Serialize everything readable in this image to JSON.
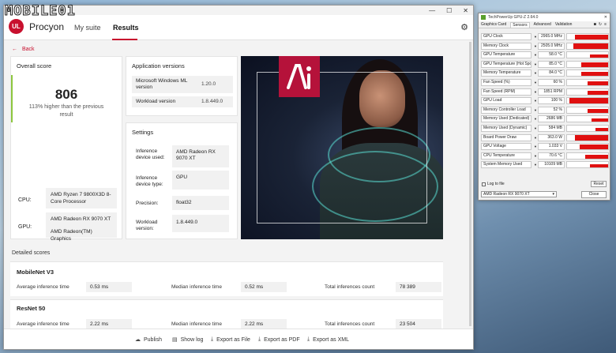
{
  "watermark": "MOBILE01",
  "window": {
    "minimize": "—",
    "maximize": "☐",
    "close": "✕"
  },
  "app": {
    "logo": "UL",
    "name": "Procyon",
    "tabs": [
      "My suite",
      "Results"
    ]
  },
  "back_label": "Back",
  "overall": {
    "title": "Overall score",
    "score": "806",
    "comparison": "113% higher than the previous result",
    "cpu_label": "CPU:",
    "cpu_value": "AMD Ryzen 7 9800X3D 8-Core Processor",
    "gpu_label": "GPU:",
    "gpu_values": [
      "AMD Radeon RX 9070 XT",
      "AMD Radeon(TM) Graphics"
    ]
  },
  "app_versions": {
    "title": "Application versions",
    "rows": [
      {
        "label": "Microsoft Windows ML version",
        "value": "1.20.0"
      },
      {
        "label": "Workload version",
        "value": "1.8.449.0"
      }
    ]
  },
  "settings": {
    "title": "Settings",
    "rows": [
      {
        "label": "Inference device used:",
        "value": "AMD Radeon RX 9070 XT"
      },
      {
        "label": "Inference device type:",
        "value": "GPU"
      },
      {
        "label": "Precision:",
        "value": "float32"
      },
      {
        "label": "Workload version:",
        "value": "1.8.449.0"
      }
    ]
  },
  "detailed_title": "Detailed scores",
  "metric_labels": {
    "avg": "Average inference time",
    "median": "Median inference time",
    "total": "Total inferences count"
  },
  "benchmarks": [
    {
      "name": "MobileNet V3",
      "avg": "0.53 ms",
      "median": "0.52 ms",
      "total": "78 389"
    },
    {
      "name": "ResNet 50",
      "avg": "2.22 ms",
      "median": "2.22 ms",
      "total": "23 504"
    }
  ],
  "footer": [
    {
      "icon": "☁",
      "label": "Publish"
    },
    {
      "icon": "▤",
      "label": "Show log"
    },
    {
      "icon": "⤓",
      "label": "Export as File"
    },
    {
      "icon": "⤓",
      "label": "Export as PDF"
    },
    {
      "icon": "⤓",
      "label": "Export as XML"
    }
  ],
  "gpuz": {
    "title": "TechPowerUp GPU-Z 2.64.0",
    "close": "✕",
    "tabs": [
      "Graphics Card",
      "Sensors",
      "Advanced",
      "Validation"
    ],
    "sensors": [
      {
        "name": "GPU Clock",
        "value": "2965.0 MHz",
        "level": 0.8
      },
      {
        "name": "Memory Clock",
        "value": "2505.0 MHz",
        "level": 0.85
      },
      {
        "name": "GPU Temperature",
        "value": "58.0 °C",
        "level": 0.45
      },
      {
        "name": "GPU Temperature (Hot Spot)",
        "value": "85.0 °C",
        "level": 0.65
      },
      {
        "name": "Memory Temperature",
        "value": "84.0 °C",
        "level": 0.65
      },
      {
        "name": "Fan Speed (%)",
        "value": "60 %",
        "level": 0.5
      },
      {
        "name": "Fan Speed (RPM)",
        "value": "1851 RPM",
        "level": 0.5
      },
      {
        "name": "GPU Load",
        "value": "100 %",
        "level": 0.95
      },
      {
        "name": "Memory Controller Load",
        "value": "52 %",
        "level": 0.5
      },
      {
        "name": "Memory Used (Dedicated)",
        "value": "2686 MB",
        "level": 0.4
      },
      {
        "name": "Memory Used (Dynamic)",
        "value": "584 MB",
        "level": 0.3
      },
      {
        "name": "Board Power Draw",
        "value": "363.0 W",
        "level": 0.8
      },
      {
        "name": "GPU Voltage",
        "value": "1.033 V",
        "level": 0.7
      },
      {
        "name": "CPU Temperature",
        "value": "70.6 °C",
        "level": 0.55
      },
      {
        "name": "System Memory Used",
        "value": "10109 MB",
        "level": 0.45
      }
    ],
    "log_label": "Log to file",
    "reset_label": "Reset",
    "device": "AMD Radeon RX 9070 XT",
    "close_label": "Close"
  }
}
